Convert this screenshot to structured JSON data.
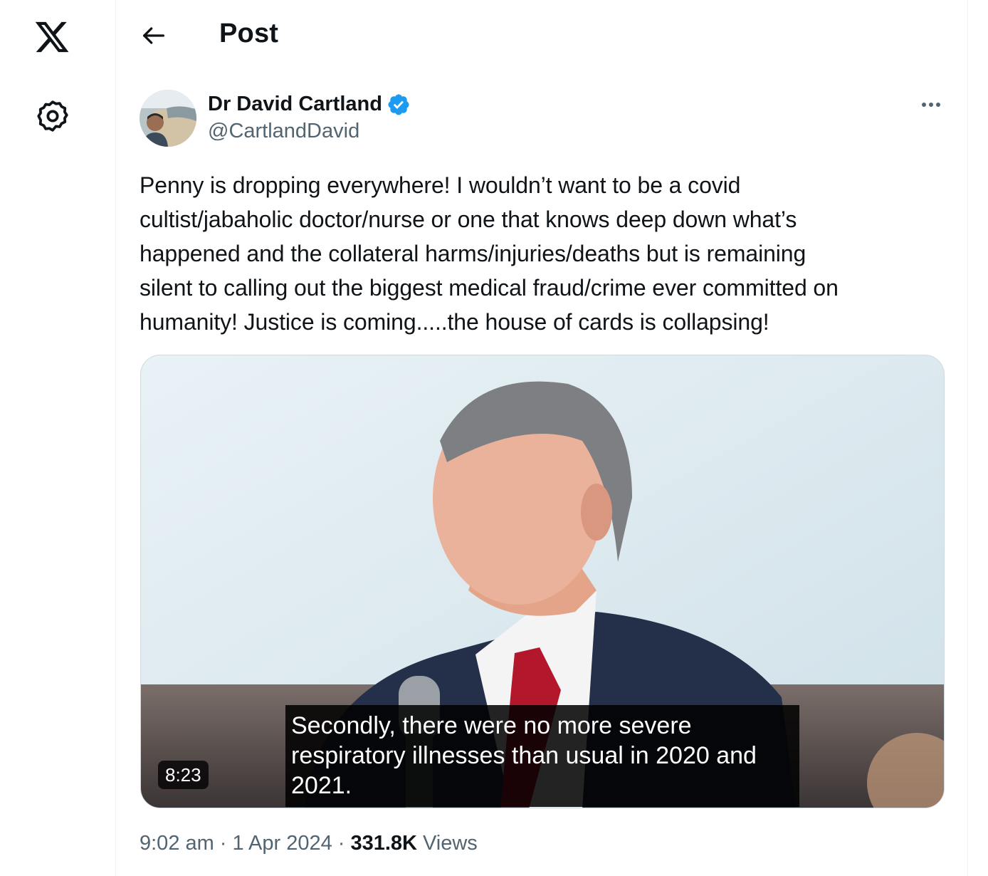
{
  "colors": {
    "accent": "#1d9bf0",
    "text": "#0f1419",
    "muted": "#536471",
    "border": "#eff3f4"
  },
  "nav": {
    "logo_icon": "x-logo-icon",
    "settings_icon": "gear-icon"
  },
  "header": {
    "back_icon": "arrow-left-icon",
    "title": "Post"
  },
  "post": {
    "author": {
      "name": "Dr David Cartland",
      "handle": "@CartlandDavid",
      "verified_icon": "verified-badge-icon"
    },
    "more_icon": "more-horizontal-icon",
    "text": "Penny is dropping everywhere! I wouldn’t want to be a covid\ncultist/jabaholic doctor/nurse or one that knows deep down what’s\nhappened and the collateral harms/injuries/deaths but is remaining\nsilent to calling out the biggest medical fraud/crime ever committed on\nhumanity!  Justice is coming.....the house of cards is collapsing!",
    "video": {
      "duration": "8:23",
      "caption": "Secondly, there were no more severe\nrespiratory illnesses than usual in 2020 and\n2021."
    },
    "meta": {
      "time": "9:02 am",
      "date": "1 Apr 2024",
      "views_count": "331.8K",
      "views_label": "Views",
      "separator": "·"
    }
  }
}
